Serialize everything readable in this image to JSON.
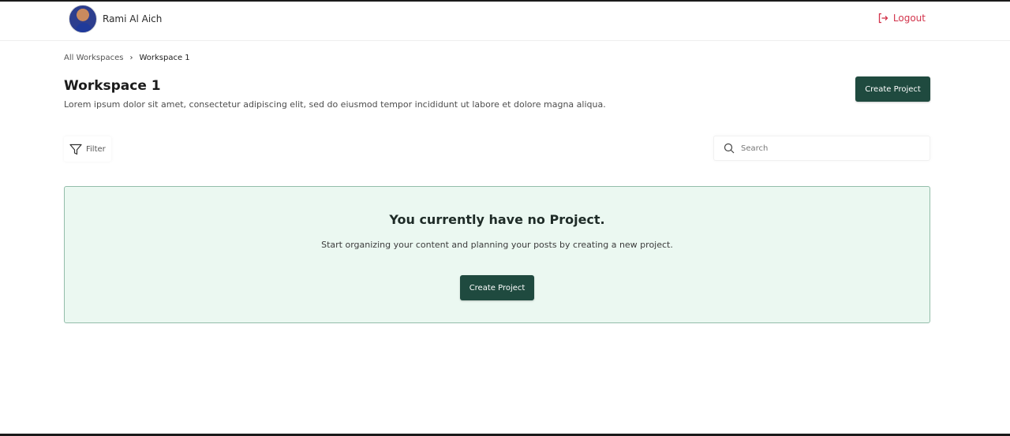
{
  "header": {
    "user_name": "Rami Al Aich",
    "logout_label": "Logout"
  },
  "breadcrumb": {
    "items": [
      "All Workspaces",
      "Workspace 1"
    ]
  },
  "page": {
    "title": "Workspace 1",
    "description": "Lorem ipsum dolor sit amet, consectetur adipiscing elit, sed do eiusmod tempor incididunt ut labore et dolore magna aliqua.",
    "create_button_label": "Create Project"
  },
  "toolbar": {
    "filter_label": "Filter",
    "search_placeholder": "Search"
  },
  "empty_state": {
    "title": "You currently have no Project.",
    "subtitle": "Start organizing your content and planning your posts by creating a new project.",
    "button_label": "Create Project"
  },
  "colors": {
    "primary": "#1f4a3f",
    "logout": "#d2334b",
    "empty_bg": "#ebf8f1",
    "empty_border": "#93bdaa"
  }
}
